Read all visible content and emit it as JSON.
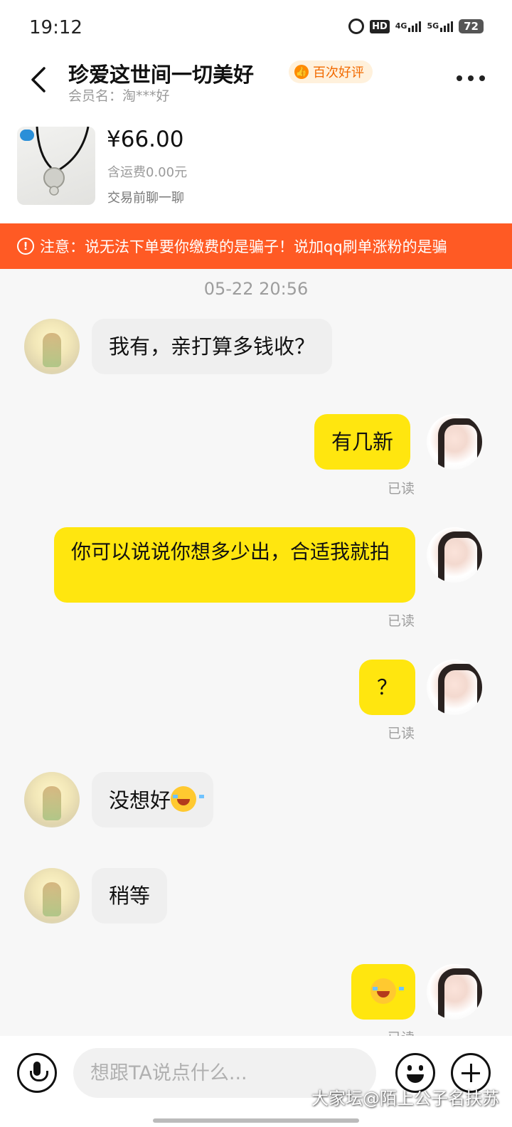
{
  "status_bar": {
    "time": "19:12",
    "battery": "72",
    "network_1": "4G",
    "network_2": "5G",
    "hd": "HD"
  },
  "header": {
    "title": "珍爱这世间一切美好",
    "member": "会员名：淘***好",
    "badge": "百次好评"
  },
  "product": {
    "price": "¥66.00",
    "shipping": "含运费0.00元",
    "note": "交易前聊一聊"
  },
  "warning": {
    "text": "注意：说无法下单要你缴费的是骗子！说加qq刷单涨粉的是骗"
  },
  "chat": {
    "timestamp": "05-22 20:56",
    "read_label": "已读",
    "messages": [
      {
        "side": "in",
        "text": "我有，亲打算多钱收？"
      },
      {
        "side": "out",
        "text": "有几新",
        "status": "已读"
      },
      {
        "side": "out",
        "text": "你可以说说你想多少出，合适我就拍",
        "status": "已读"
      },
      {
        "side": "out",
        "text": "？",
        "status": "已读"
      },
      {
        "side": "in",
        "text": "没想好",
        "emoji": "crying-laughing-emoji"
      },
      {
        "side": "in",
        "text": "稍等"
      },
      {
        "side": "out",
        "text": "",
        "emoji": "crying-laughing-emoji",
        "status": "已读"
      }
    ]
  },
  "input": {
    "placeholder": "想跟TA说点什么..."
  },
  "watermark": "大家坛@陌上公子名扶苏",
  "colors": {
    "accent": "#ffe60f",
    "warning": "#ff5a24",
    "badge_text": "#f26a00"
  }
}
